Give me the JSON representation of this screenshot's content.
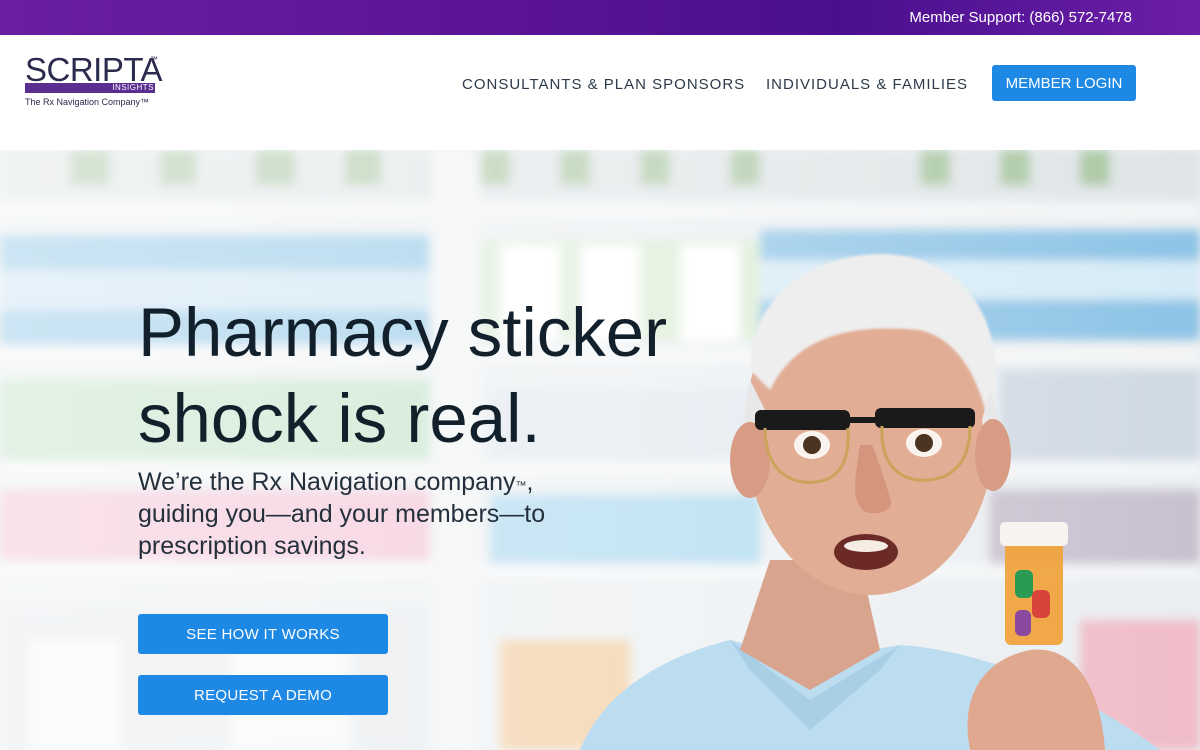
{
  "topbar": {
    "support_text": "Member Support: (866) 572-7478"
  },
  "header": {
    "logo": {
      "wordmark": "SCRIPTA",
      "sub": "INSIGHTS",
      "tagline": "The Rx Navigation Company™"
    },
    "nav": {
      "consultants": "CONSULTANTS & PLAN SPONSORS",
      "individuals": "INDIVIDUALS & FAMILIES",
      "login": "MEMBER LOGIN"
    }
  },
  "hero": {
    "title": "Pharmacy sticker shock is real.",
    "subtitle_part1": "We’re the Rx Navigation company",
    "subtitle_tm": "™",
    "subtitle_part2": ", guiding you—and your members—to prescription savings.",
    "cta_primary": "SEE HOW IT WORKS",
    "cta_secondary": "REQUEST A DEMO"
  },
  "colors": {
    "topbar": "#5a1396",
    "accent": "#1e88e5",
    "heading": "#12202c"
  }
}
